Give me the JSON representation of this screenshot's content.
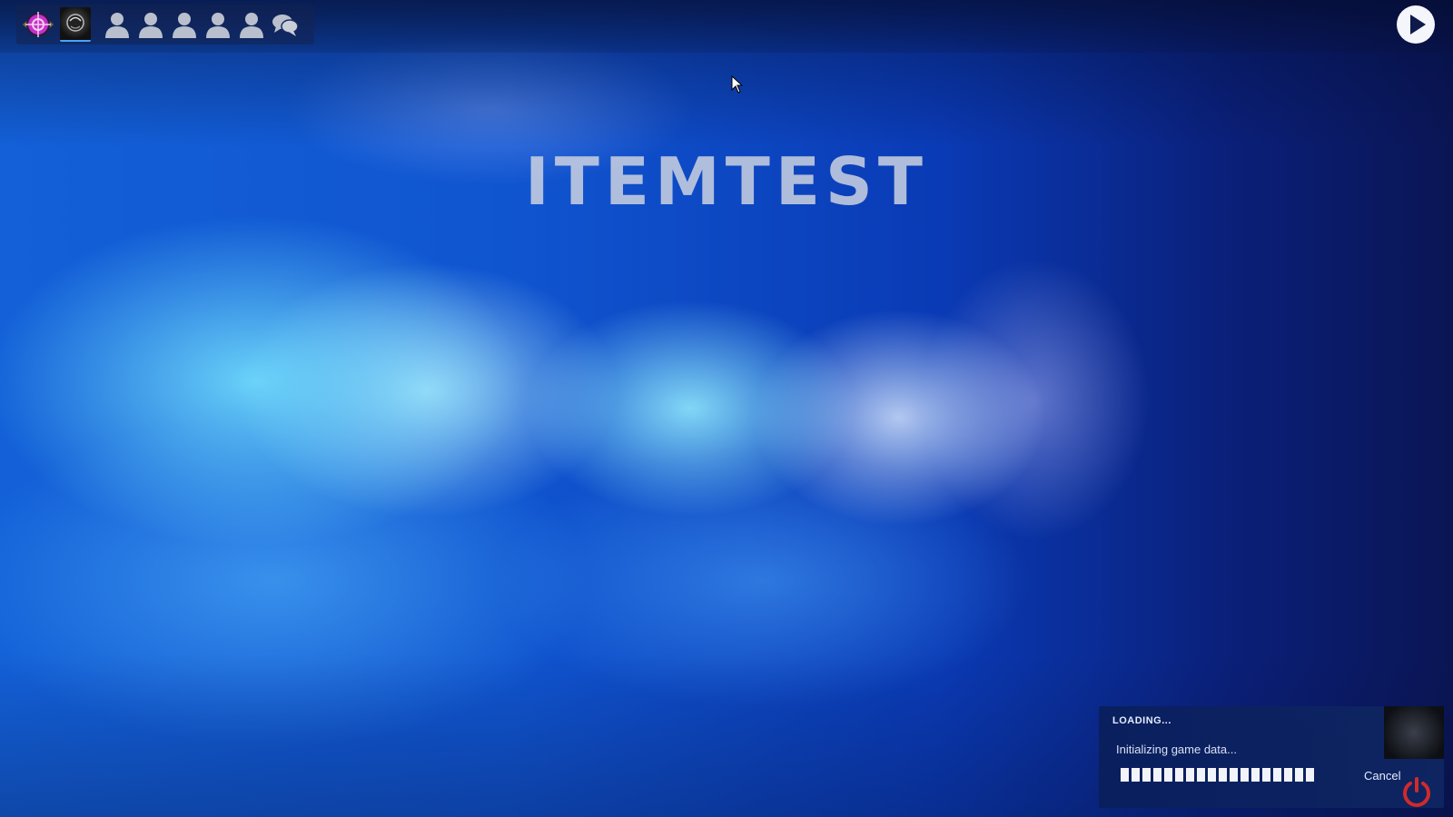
{
  "game": {
    "title": "ITEMTEST"
  },
  "toolbar": {
    "icons": [
      "game-logo-icon",
      "player-portrait-icon",
      "friend-icon",
      "friend-icon",
      "friend-icon",
      "friend-icon",
      "friend-icon",
      "chat-icon"
    ]
  },
  "play_button": {
    "icon": "play-icon"
  },
  "loading": {
    "heading": "LOADING...",
    "status": "Initializing game data...",
    "progress_segments_filled": 18,
    "cancel_label": "Cancel",
    "power_icon": "power-icon"
  },
  "colors": {
    "accent": "#4aa3ff",
    "power": "#d12a2a",
    "title_text": "#cdd2e1"
  }
}
